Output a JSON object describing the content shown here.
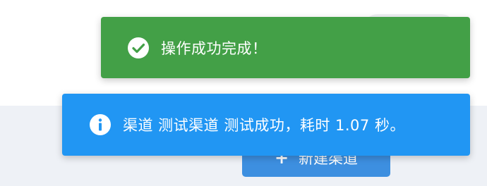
{
  "background": {
    "create_button_label": "新建渠道",
    "create_button_icon": "plus-icon"
  },
  "toasts": [
    {
      "type": "success",
      "icon": "check-circle-icon",
      "message": "操作成功完成！",
      "color": "#43a047"
    },
    {
      "type": "info",
      "icon": "info-circle-icon",
      "message": "渠道 测试渠道 测试成功，耗时 1.07 秒。",
      "color": "#2196f3"
    }
  ]
}
